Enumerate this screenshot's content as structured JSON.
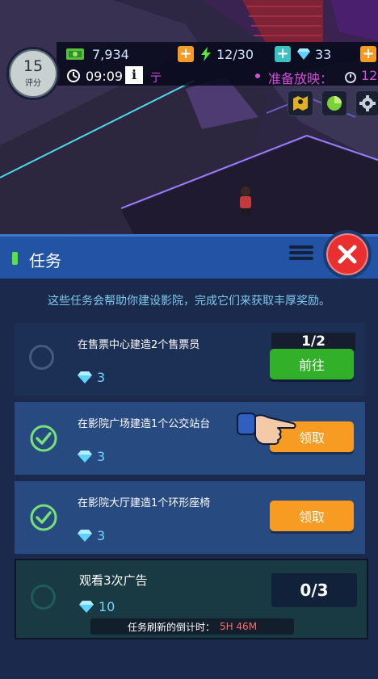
{
  "hud": {
    "score_value": "15",
    "score_label": "评分",
    "money": "7,934",
    "energy": "12/30",
    "gems": "33",
    "time": "09:09",
    "info_label": "i",
    "ticker_fragment": "亍",
    "screening_status": "准备放映：",
    "countdown": "12"
  },
  "panel": {
    "title": "任务",
    "description": "这些任务会帮助你建设影院，完成它们来获取丰厚奖励。",
    "tasks": [
      {
        "text": "在售票中心建造2个售票员",
        "reward": "3",
        "progress": "1/2",
        "button": "前往"
      },
      {
        "text": "在影院广场建造1个公交站台",
        "reward": "3",
        "button": "领取"
      },
      {
        "text": "在影院大厅建造1个环形座椅",
        "reward": "3",
        "button": "领取"
      },
      {
        "text": "观看3次广告",
        "reward": "10",
        "progress": "0/3"
      }
    ],
    "refresh_label": "任务刷新的倒计时：",
    "refresh_time": "5H 46M"
  },
  "colors": {
    "panel_bg": "#1b2a4c",
    "header_blue": "#2253a4",
    "accent_green": "#33b02a",
    "accent_orange": "#f79b22",
    "gem_blue": "#6fd6ff",
    "check_green": "#77e07a",
    "close_red": "#ea2f2f",
    "refresh_time_red": "#ff6a6a"
  }
}
